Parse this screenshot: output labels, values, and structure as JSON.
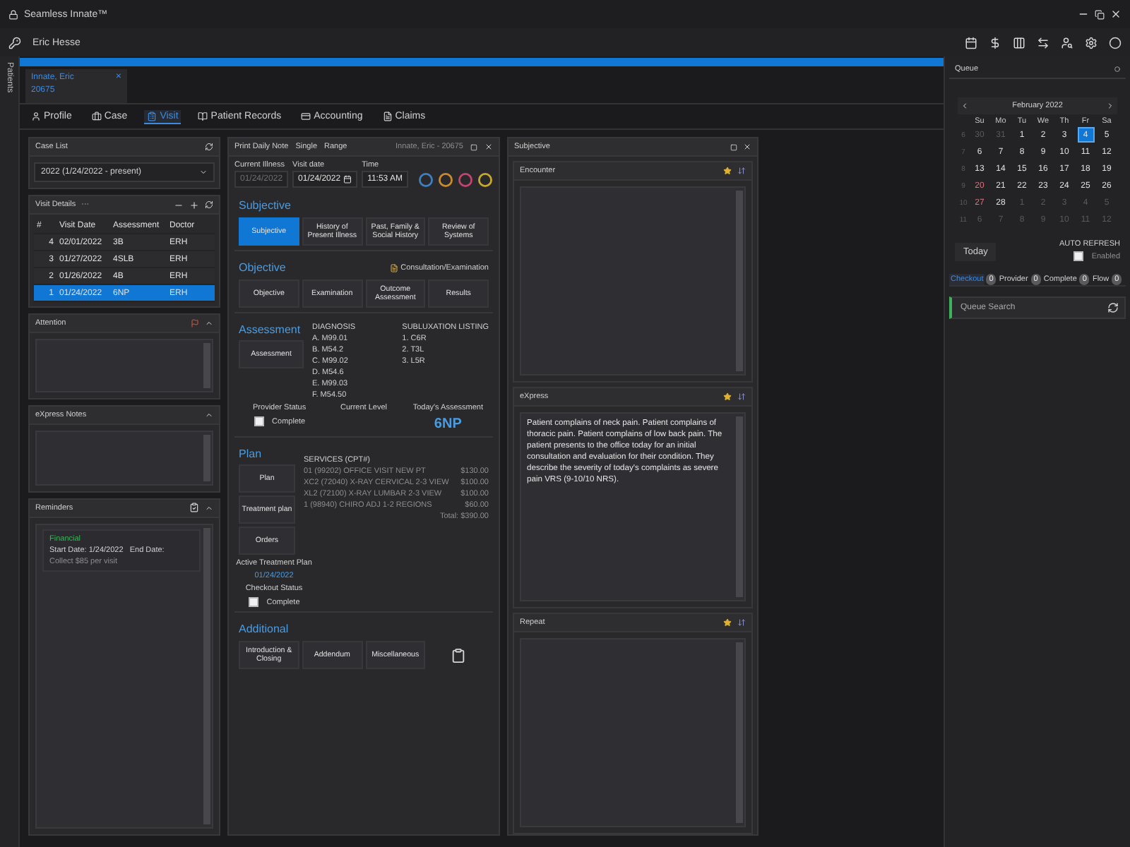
{
  "window": {
    "title": "Seamless Innate™",
    "user": "Eric Hesse",
    "rail_label": "Patients"
  },
  "progress": {
    "level": 1
  },
  "patient_tab": {
    "name": "Innate, Eric",
    "id": "20675",
    "close": "×"
  },
  "nav_tabs": [
    {
      "label": "Profile",
      "selected": false
    },
    {
      "label": "Case",
      "selected": false
    },
    {
      "label": "Visit",
      "selected": true
    },
    {
      "label": "Patient Records",
      "selected": false
    },
    {
      "label": "Accounting",
      "selected": false
    },
    {
      "label": "Claims",
      "selected": false
    }
  ],
  "case_list": {
    "title": "Case List",
    "value": "2022 (1/24/2022 - present)"
  },
  "visit_details": {
    "title": "Visit Details",
    "more": "···",
    "columns": [
      "#",
      "Visit Date",
      "Assessment",
      "Doctor"
    ],
    "rows": [
      {
        "num": "4",
        "date": "02/01/2022",
        "assessment": "3B",
        "doctor": "ERH",
        "selected": false
      },
      {
        "num": "3",
        "date": "01/27/2022",
        "assessment": "4SLB",
        "doctor": "ERH",
        "selected": false
      },
      {
        "num": "2",
        "date": "01/26/2022",
        "assessment": "4B",
        "doctor": "ERH",
        "selected": false
      },
      {
        "num": "1",
        "date": "01/24/2022",
        "assessment": "6NP",
        "doctor": "ERH",
        "selected": true
      }
    ]
  },
  "attention": {
    "title": "Attention"
  },
  "express_notes": {
    "title": "eXpress Notes"
  },
  "reminders": {
    "title": "Reminders",
    "items": [
      {
        "tag": "Financial",
        "dates": "Start Date: 1/24/2022   End Date:",
        "note": "Collect $85 per visit"
      }
    ]
  },
  "daily_note": {
    "toolbar": [
      "Print Daily Note",
      "Single",
      "Range"
    ],
    "patient": "Innate, Eric - 20675",
    "fields": [
      {
        "label": "Current Illness",
        "value": "01/24/2022",
        "disabled": true
      },
      {
        "label": "Visit date",
        "value": "01/24/2022",
        "disabled": false
      },
      {
        "label": "Time",
        "value": "11:53 AM",
        "disabled": false
      }
    ],
    "rings": [
      {
        "color": "#3f7fbf"
      },
      {
        "color": "#c98a2e"
      },
      {
        "color": "#c2456b"
      },
      {
        "color": "#c9a72e"
      }
    ],
    "subjective": {
      "title": "Subjective",
      "buttons": [
        {
          "label": "Subjective",
          "selected": true
        },
        {
          "label": "History of Present Illness",
          "selected": false
        },
        {
          "label": "Past, Family & Social History",
          "selected": false
        },
        {
          "label": "Review of Systems",
          "selected": false
        }
      ]
    },
    "objective": {
      "title": "Objective",
      "link": "Consultation/Examination",
      "buttons": [
        {
          "label": "Objective",
          "selected": false
        },
        {
          "label": "Examination",
          "selected": false
        },
        {
          "label": "Outcome Assessment",
          "selected": false
        },
        {
          "label": "Results",
          "selected": false
        }
      ]
    },
    "assessment": {
      "title": "Assessment",
      "button": "Assessment",
      "diagnosis_heading": "DIAGNOSIS",
      "diagnosis": [
        "A. M99.01",
        "B. M54.2",
        "C. M99.02",
        "D. M54.6",
        "E. M99.03",
        "F. M54.50"
      ],
      "subluxation_heading": "SUBLUXATION LISTING",
      "subluxation": [
        "1. C6R",
        "2. T3L",
        "3. L5R"
      ],
      "provider_status": "Provider Status",
      "complete": {
        "label": "Complete",
        "checked": false
      },
      "current_level": "Current Level",
      "todays_assessment": "Today's Assessment",
      "level": "6NP"
    },
    "plan": {
      "title": "Plan",
      "buttons": [
        "Plan",
        "Treatment plan",
        "Orders"
      ],
      "services_heading": "SERVICES (CPT#)",
      "services": [
        {
          "name": "01 (99202) OFFICE VISIT NEW PT",
          "price": "$130.00"
        },
        {
          "name": "XC2 (72040) X-RAY CERVICAL 2-3 VIEW",
          "price": "$100.00"
        },
        {
          "name": "XL2 (72100) X-RAY LUMBAR 2-3 VIEW",
          "price": "$100.00"
        },
        {
          "name": "1 (98940) CHIRO ADJ 1-2 REGIONS",
          "price": "$60.00"
        }
      ],
      "total": "Total: $390.00",
      "active_plan_label": "Active Treatment Plan",
      "active_plan": "01/24/2022",
      "checkout_status": "Checkout Status",
      "checkout": {
        "label": "Complete",
        "checked": false
      }
    },
    "additional": {
      "title": "Additional",
      "buttons": [
        "Introduction & Closing",
        "Addendum",
        "Miscellaneous"
      ]
    }
  },
  "subjective_panel": {
    "title": "Subjective",
    "sections": [
      {
        "title": "Encounter"
      },
      {
        "title": "eXpress",
        "text": "Patient complains of neck pain.  Patient complains of thoracic pain.  Patient complains of low back pain.  The patient presents to the office today for an initial consultation and evaluation for their condition. They describe the severity of today's complaints as severe pain VRS (9-10/10 NRS)."
      },
      {
        "title": "Repeat"
      }
    ]
  },
  "queue": {
    "title": "Queue",
    "month": "February 2022",
    "weekdays": [
      "Su",
      "Mo",
      "Tu",
      "We",
      "Th",
      "Fr",
      "Sa"
    ],
    "weeks": [
      {
        "week": "6",
        "days": [
          {
            "d": "30",
            "muted": true,
            "selected": false,
            "marked": false
          },
          {
            "d": "31",
            "muted": true,
            "selected": false,
            "marked": false
          },
          {
            "d": "1",
            "muted": false,
            "selected": false,
            "marked": false
          },
          {
            "d": "2",
            "muted": false,
            "selected": false,
            "marked": false
          },
          {
            "d": "3",
            "muted": false,
            "selected": false,
            "marked": false
          },
          {
            "d": "4",
            "muted": false,
            "selected": true,
            "marked": false
          },
          {
            "d": "5",
            "muted": false,
            "selected": false,
            "marked": false
          }
        ]
      },
      {
        "week": "7",
        "days": [
          {
            "d": "6",
            "muted": false,
            "selected": false,
            "marked": false
          },
          {
            "d": "7",
            "muted": false,
            "selected": false,
            "marked": false
          },
          {
            "d": "8",
            "muted": false,
            "selected": false,
            "marked": false
          },
          {
            "d": "9",
            "muted": false,
            "selected": false,
            "marked": false
          },
          {
            "d": "10",
            "muted": false,
            "selected": false,
            "marked": false
          },
          {
            "d": "11",
            "muted": false,
            "selected": false,
            "marked": false
          },
          {
            "d": "12",
            "muted": false,
            "selected": false,
            "marked": false
          }
        ]
      },
      {
        "week": "8",
        "days": [
          {
            "d": "13",
            "muted": false,
            "selected": false,
            "marked": false
          },
          {
            "d": "14",
            "muted": false,
            "selected": false,
            "marked": false
          },
          {
            "d": "15",
            "muted": false,
            "selected": false,
            "marked": false
          },
          {
            "d": "16",
            "muted": false,
            "selected": false,
            "marked": false
          },
          {
            "d": "17",
            "muted": false,
            "selected": false,
            "marked": false
          },
          {
            "d": "18",
            "muted": false,
            "selected": false,
            "marked": false
          },
          {
            "d": "19",
            "muted": false,
            "selected": false,
            "marked": false
          }
        ]
      },
      {
        "week": "9",
        "days": [
          {
            "d": "20",
            "muted": false,
            "selected": false,
            "marked": true
          },
          {
            "d": "21",
            "muted": false,
            "selected": false,
            "marked": false
          },
          {
            "d": "22",
            "muted": false,
            "selected": false,
            "marked": false
          },
          {
            "d": "23",
            "muted": false,
            "selected": false,
            "marked": false
          },
          {
            "d": "24",
            "muted": false,
            "selected": false,
            "marked": false
          },
          {
            "d": "25",
            "muted": false,
            "selected": false,
            "marked": false
          },
          {
            "d": "26",
            "muted": false,
            "selected": false,
            "marked": false
          }
        ]
      },
      {
        "week": "10",
        "days": [
          {
            "d": "27",
            "muted": false,
            "selected": false,
            "marked": true
          },
          {
            "d": "28",
            "muted": false,
            "selected": false,
            "marked": false
          },
          {
            "d": "1",
            "muted": true,
            "selected": false,
            "marked": false
          },
          {
            "d": "2",
            "muted": true,
            "selected": false,
            "marked": false
          },
          {
            "d": "3",
            "muted": true,
            "selected": false,
            "marked": false
          },
          {
            "d": "4",
            "muted": true,
            "selected": false,
            "marked": false
          },
          {
            "d": "5",
            "muted": true,
            "selected": false,
            "marked": false
          }
        ]
      },
      {
        "week": "11",
        "days": [
          {
            "d": "6",
            "muted": true,
            "selected": false,
            "marked": false
          },
          {
            "d": "7",
            "muted": true,
            "selected": false,
            "marked": false
          },
          {
            "d": "8",
            "muted": true,
            "selected": false,
            "marked": false
          },
          {
            "d": "9",
            "muted": true,
            "selected": false,
            "marked": false
          },
          {
            "d": "10",
            "muted": true,
            "selected": false,
            "marked": false
          },
          {
            "d": "11",
            "muted": true,
            "selected": false,
            "marked": false
          },
          {
            "d": "12",
            "muted": true,
            "selected": false,
            "marked": false
          }
        ]
      }
    ],
    "today": "Today",
    "auto_refresh": "AUTO REFRESH",
    "enabled": {
      "label": "Enabled",
      "checked": false
    },
    "tabs": [
      {
        "label": "Checkout",
        "count": "0",
        "selected": true
      },
      {
        "label": "Provider",
        "count": "0",
        "selected": false
      },
      {
        "label": "Complete",
        "count": "0",
        "selected": false
      },
      {
        "label": "Flow",
        "count": "0",
        "selected": false
      }
    ],
    "search_placeholder": "Queue Search"
  }
}
